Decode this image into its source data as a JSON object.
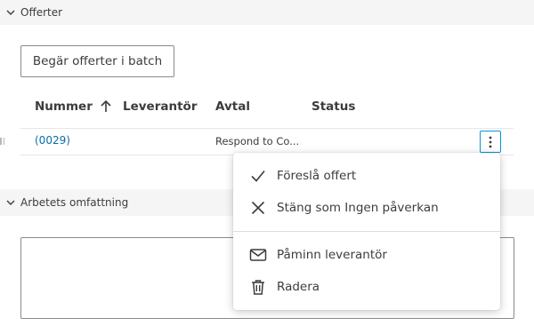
{
  "sections": {
    "offers_title": "Offerter",
    "scope_title": "Arbetets omfattning"
  },
  "toolbar": {
    "batch_request_label": "Begär offerter i batch"
  },
  "table": {
    "columns": [
      "Nummer",
      "Leverantör",
      "Avtal",
      "Status"
    ],
    "sort": {
      "column": "Nummer",
      "direction": "ascending"
    },
    "rows": [
      {
        "number": "(0029)",
        "supplier": "",
        "contract": "Respond to Co...",
        "status": ""
      }
    ]
  },
  "context_menu": {
    "items": [
      {
        "label": "Föreslå offert",
        "icon": "checkmark-icon"
      },
      {
        "label": "Stäng som Ingen påverkan",
        "icon": "close-icon"
      },
      {
        "label": "Påminn leverantör",
        "icon": "envelope-icon"
      },
      {
        "label": "Radera",
        "icon": "trash-icon"
      }
    ]
  },
  "scope": {
    "text": ""
  },
  "colors": {
    "link": "#0a6eaa",
    "accent_border": "#0696d7",
    "section_bg": "#f5f5f5"
  }
}
